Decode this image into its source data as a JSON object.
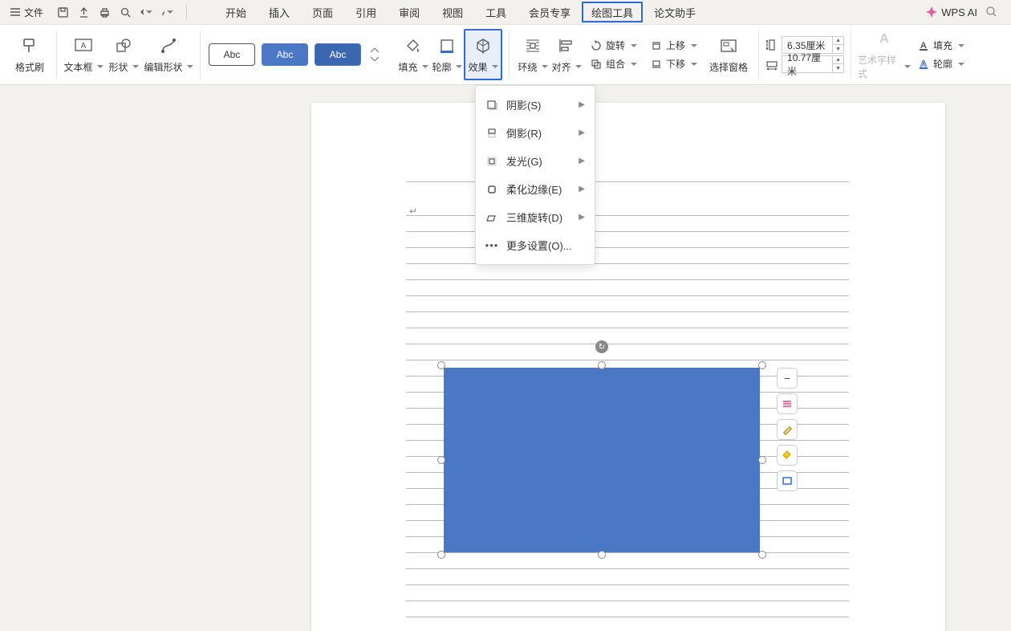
{
  "menubar": {
    "file": "文件",
    "tabs": [
      "开始",
      "插入",
      "页面",
      "引用",
      "审阅",
      "视图",
      "工具",
      "会员专享",
      "绘图工具",
      "论文助手"
    ],
    "active_tab": "绘图工具",
    "wps_ai": "WPS AI"
  },
  "ribbon": {
    "format_painter": "格式刷",
    "textbox": "文本框",
    "shape": "形状",
    "edit_shape": "编辑形状",
    "preset1": "Abc",
    "preset2": "Abc",
    "preset3": "Abc",
    "fill": "填充",
    "outline": "轮廓",
    "effect": "效果",
    "wrap": "环绕",
    "align": "对齐",
    "rotate": "旋转",
    "group": "组合",
    "move_up": "上移",
    "move_down": "下移",
    "selection_pane": "选择窗格",
    "height_value": "6.35厘米",
    "width_value": "10.77厘米",
    "art_style": "艺术字样式",
    "text_fill": "填充",
    "text_outline": "轮廓"
  },
  "dropdown": {
    "items": [
      {
        "label": "阴影(S)",
        "arrow": true
      },
      {
        "label": "倒影(R)",
        "arrow": true
      },
      {
        "label": "发光(G)",
        "arrow": true
      },
      {
        "label": "柔化边缘(E)",
        "arrow": true
      },
      {
        "label": "三维旋转(D)",
        "arrow": true
      },
      {
        "label": "更多设置(O)...",
        "arrow": false
      }
    ]
  },
  "shape": {
    "fill_color": "#4a78c5",
    "height_cm": 6.35,
    "width_cm": 10.77
  }
}
